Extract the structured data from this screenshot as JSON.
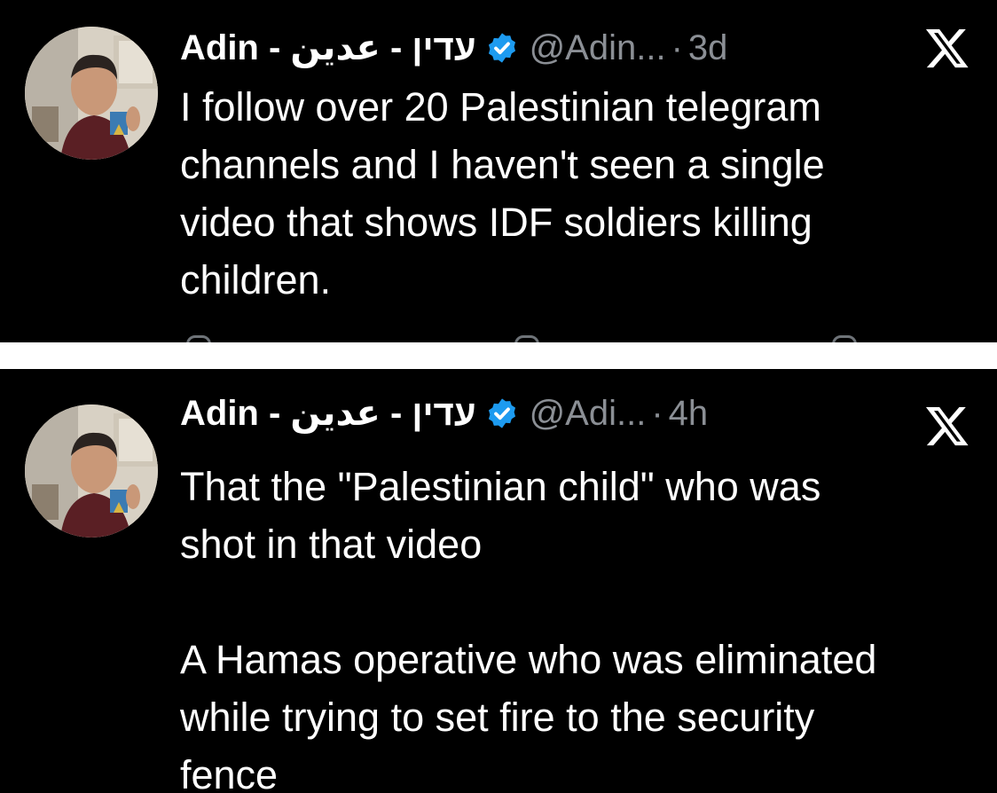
{
  "tweets": [
    {
      "display_name": "Adin - עדין - عدين",
      "handle": "@Adin...",
      "dot": "·",
      "time": "3d",
      "text": "I follow over 20 Palestinian telegram\nchannels and I haven't seen a single\nvideo that shows IDF soldiers killing\nchildren.",
      "avatar_icon": "profile-avatar",
      "verified_icon": "verified-badge-icon",
      "brand_icon": "x-logo-icon"
    },
    {
      "display_name": "Adin - עדין - عدين",
      "handle": "@Adi...",
      "dot": "·",
      "time": "4h",
      "text": "That the \"Palestinian child\" who was\nshot in that video\n\nA Hamas operative who was eliminated\nwhile trying to set fire to the security\nfence",
      "avatar_icon": "profile-avatar",
      "verified_icon": "verified-badge-icon",
      "brand_icon": "x-logo-icon"
    }
  ],
  "colors": {
    "background": "#000000",
    "separator": "#ffffff",
    "text": "#ffffff",
    "muted": "#8b8f95",
    "verified": "#1d9bf0"
  }
}
